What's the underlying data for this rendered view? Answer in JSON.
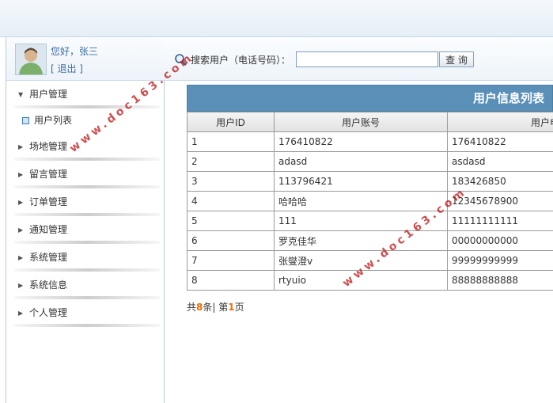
{
  "user": {
    "greeting": "您好，张三",
    "logout": "[ 退出 ]"
  },
  "menu": {
    "user_mgmt": "用户管理",
    "user_list": "用户列表",
    "venue_mgmt": "场地管理",
    "message_mgmt": "留言管理",
    "order_mgmt": "订单管理",
    "notice_mgmt": "通知管理",
    "system_mgmt": "系统管理",
    "system_info": "系统信息",
    "personal_mgmt": "个人管理"
  },
  "search": {
    "label": "搜索用户（电话号码）：",
    "value": "",
    "button": "查 询"
  },
  "table": {
    "title": "用户信息列表",
    "headers": {
      "id": "用户ID",
      "account": "用户账号",
      "phone": "用户电话号"
    },
    "rows": [
      {
        "id": "1",
        "account": "176410822",
        "phone": "176410822"
      },
      {
        "id": "2",
        "account": "adasd",
        "phone": "asdasd"
      },
      {
        "id": "3",
        "account": "113796421",
        "phone": "183426850"
      },
      {
        "id": "4",
        "account": "哈哈哈",
        "phone": "12345678900"
      },
      {
        "id": "5",
        "account": "111",
        "phone": "11111111111"
      },
      {
        "id": "6",
        "account": "罗克佳华",
        "phone": "00000000000"
      },
      {
        "id": "7",
        "account": "张燮澄v",
        "phone": "99999999999"
      },
      {
        "id": "8",
        "account": "rtyuio",
        "phone": "88888888888"
      }
    ]
  },
  "pager": {
    "prefix": "共",
    "total": "8",
    "mid": "条| 第",
    "page": "1",
    "suffix": "页"
  },
  "watermark": {
    "text": "www.doc163.com"
  },
  "colors": {
    "table_header": "#5a90b8",
    "accent_link": "#3a6ea5",
    "pager_number": "#ef6c00",
    "watermark": "#be1414"
  },
  "icons": {
    "avatar": "user-avatar",
    "search": "magnifier-icon",
    "caret_open": "caret-down-icon",
    "caret_closed": "caret-right-icon",
    "list_bullet": "square-bullet-icon"
  }
}
